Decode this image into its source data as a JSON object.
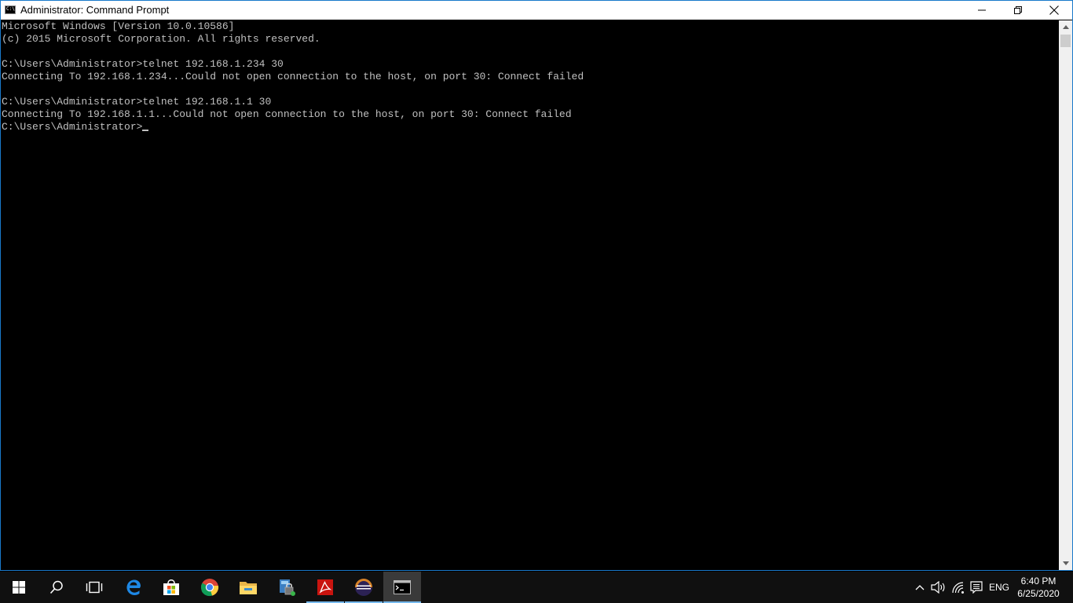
{
  "window": {
    "title": "Administrator: Command Prompt",
    "icon_text": "C:\\"
  },
  "console": {
    "lines": [
      "Microsoft Windows [Version 10.0.10586]",
      "(c) 2015 Microsoft Corporation. All rights reserved.",
      "",
      "C:\\Users\\Administrator>telnet 192.168.1.234 30",
      "Connecting To 192.168.1.234...Could not open connection to the host, on port 30: Connect failed",
      "",
      "C:\\Users\\Administrator>telnet 192.168.1.1 30",
      "Connecting To 192.168.1.1...Could not open connection to the host, on port 30: Connect failed",
      ""
    ],
    "prompt": "C:\\Users\\Administrator>",
    "text_color": "#c0c0c0",
    "background": "#000000"
  },
  "taskbar": {
    "pinned": [
      {
        "name": "start",
        "icon": "windows-logo-icon"
      },
      {
        "name": "search",
        "icon": "search-icon"
      },
      {
        "name": "task-view",
        "icon": "task-view-icon"
      },
      {
        "name": "edge",
        "icon": "edge-icon"
      },
      {
        "name": "store",
        "icon": "store-icon"
      },
      {
        "name": "chrome",
        "icon": "chrome-icon"
      },
      {
        "name": "file-explorer",
        "icon": "folder-icon"
      },
      {
        "name": "security-app",
        "icon": "lock-app-icon"
      },
      {
        "name": "acrobat",
        "icon": "acrobat-icon"
      },
      {
        "name": "eclipse",
        "icon": "eclipse-icon"
      },
      {
        "name": "command-prompt",
        "icon": "cmd-icon"
      }
    ],
    "tray": {
      "language": "ENG",
      "time": "6:40 PM",
      "date": "6/25/2020"
    },
    "accent_color": "#76b9ed"
  }
}
